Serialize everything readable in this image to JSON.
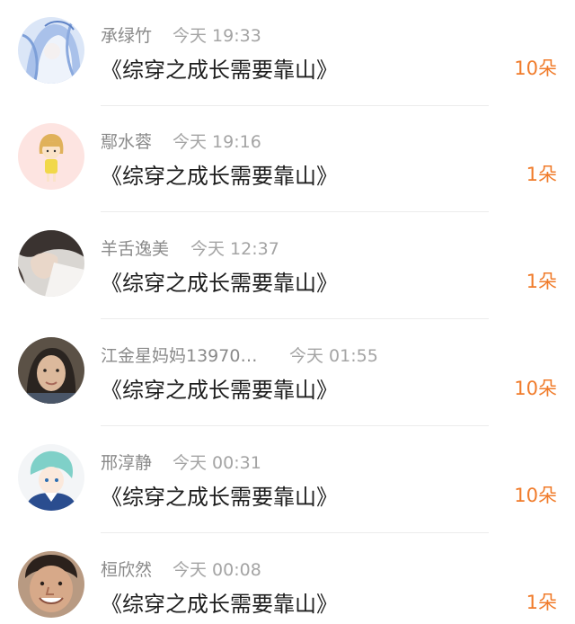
{
  "comments": [
    {
      "user": "承绿竹",
      "time": "今天  19:33",
      "title": "《综穿之成长需要靠山》",
      "count": "10朵",
      "avatar_icon": "anime-girl-avatar-icon"
    },
    {
      "user": "鄢水蓉",
      "time": "今天  19:16",
      "title": "《综穿之成长需要靠山》",
      "count": "1朵",
      "avatar_icon": "cartoon-girl-avatar-icon"
    },
    {
      "user": "羊舌逸美",
      "time": "今天  12:37",
      "title": "《综穿之成长需要靠山》",
      "count": "1朵",
      "avatar_icon": "portrait-avatar-icon"
    },
    {
      "user": "江金星妈妈13970…",
      "time": "今天  01:55",
      "title": "《综穿之成长需要靠山》",
      "count": "10朵",
      "avatar_icon": "woman-photo-avatar-icon"
    },
    {
      "user": "邢淳静",
      "time": "今天  00:31",
      "title": "《综穿之成长需要靠山》",
      "count": "10朵",
      "avatar_icon": "anime-boy-avatar-icon"
    },
    {
      "user": "桓欣然",
      "time": "今天  00:08",
      "title": "《综穿之成长需要靠山》",
      "count": "1朵",
      "avatar_icon": "man-face-avatar-icon"
    }
  ],
  "colors": {
    "accent": "#f07b2a",
    "name": "#8a8a8a",
    "time": "#a4a4a4",
    "title": "#1e1e1e"
  }
}
